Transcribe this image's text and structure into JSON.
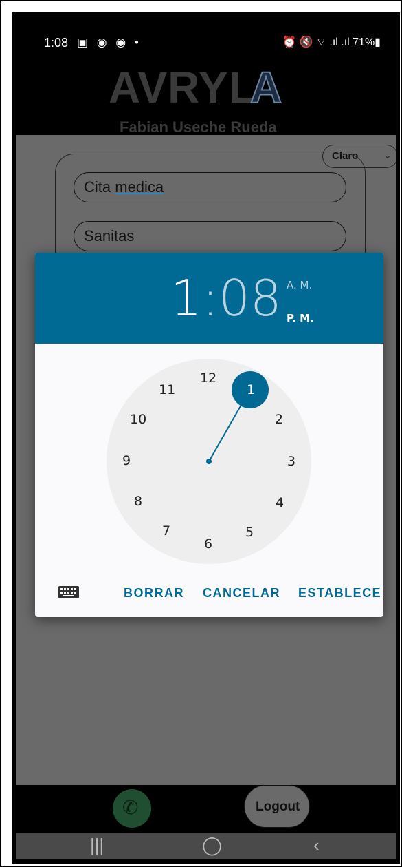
{
  "status_bar": {
    "time": "1:08",
    "left_icons": "▣ ◉ ◉ •",
    "right_icons": "⏰ 🔇 ⌔ .ıl .ıl 71%▮"
  },
  "header": {
    "logo_text": "AVRYL",
    "logo_mark": "A",
    "subtitle": "Fabian Useche Rueda"
  },
  "theme_select": {
    "value": "Claro",
    "chevron": "⌄"
  },
  "form": {
    "field1": "Cita medica",
    "field1_prefix": "Cita ",
    "field1_underlined": "medica",
    "field2": "Sanitas"
  },
  "time_picker": {
    "hour": "1",
    "separator": ":",
    "minute": "08",
    "am_label": "A. M.",
    "pm_label": "P. M.",
    "selected_period": "P. M.",
    "selected_hour": "1",
    "dial_numbers": [
      "12",
      "1",
      "2",
      "3",
      "4",
      "5",
      "6",
      "7",
      "8",
      "9",
      "10",
      "11"
    ],
    "buttons": {
      "clear": "BORRAR",
      "cancel": "CANCELAR",
      "set": "ESTABLECE"
    },
    "accent_color": "#006994"
  },
  "bottom_bar": {
    "whatsapp_icon": "whatsapp-icon",
    "logout_label": "Logout"
  },
  "nav": {
    "recents": "|||",
    "home": "◯",
    "back": "‹"
  }
}
